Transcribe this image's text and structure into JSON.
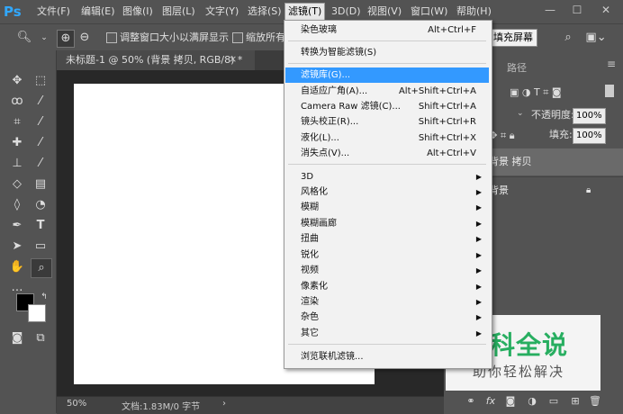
{
  "app": {
    "logo": "Ps"
  },
  "menubar": {
    "items": [
      "文件(F)",
      "编辑(E)",
      "图像(I)",
      "图层(L)",
      "文字(Y)",
      "选择(S)",
      "滤镜(T)",
      "3D(D)",
      "视图(V)",
      "窗口(W)",
      "帮助(H)"
    ],
    "active": "滤镜(T)"
  },
  "options": {
    "resize_label": "调整窗口大小以满屏显示",
    "zoom_all_label": "缩放所有",
    "fill_screen": "填充屏幕"
  },
  "document": {
    "tab_title": "未标题-1 @ 50% (背景 拷贝, RGB/8) *",
    "zoom": "50%",
    "status": "文档:1.83M/0 字节"
  },
  "right_panel": {
    "tab_paths": "路径",
    "opacity_label": "不透明度:",
    "opacity_value": "100%",
    "fill_label": "填充:",
    "fill_value": "100%",
    "layers": [
      "背景 拷贝",
      "背景"
    ]
  },
  "filter_menu": {
    "top": [
      {
        "label": "染色玻璃",
        "shortcut": "Alt+Ctrl+F"
      }
    ],
    "smart": {
      "label": "转换为智能滤镜(S)"
    },
    "group1": [
      {
        "label": "滤镜库(G)...",
        "shortcut": "",
        "highlight": true
      },
      {
        "label": "自适应广角(A)...",
        "shortcut": "Alt+Shift+Ctrl+A"
      },
      {
        "label": "Camera Raw 滤镜(C)...",
        "shortcut": "Shift+Ctrl+A"
      },
      {
        "label": "镜头校正(R)...",
        "shortcut": "Shift+Ctrl+R"
      },
      {
        "label": "液化(L)...",
        "shortcut": "Shift+Ctrl+X"
      },
      {
        "label": "消失点(V)...",
        "shortcut": "Alt+Ctrl+V"
      }
    ],
    "submenus": [
      "3D",
      "风格化",
      "模糊",
      "模糊画廊",
      "扭曲",
      "锐化",
      "视频",
      "像素化",
      "渲染",
      "杂色",
      "其它"
    ],
    "browse": "浏览联机滤镜..."
  },
  "watermark": {
    "title": "百科全说",
    "subtitle": "助你轻松解决"
  }
}
